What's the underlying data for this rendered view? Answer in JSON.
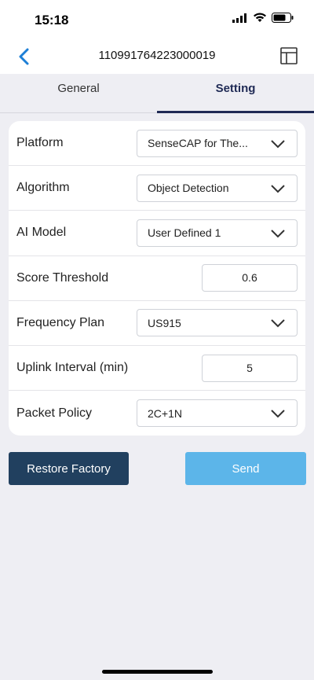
{
  "status_bar": {
    "time": "15:18"
  },
  "nav": {
    "title": "110991764223000019"
  },
  "tabs": [
    {
      "label": "General",
      "active": false
    },
    {
      "label": "Setting",
      "active": true
    }
  ],
  "settings": {
    "platform": {
      "label": "Platform",
      "value": "SenseCAP for The..."
    },
    "algorithm": {
      "label": "Algorithm",
      "value": "Object Detection"
    },
    "ai_model": {
      "label": "AI Model",
      "value": "User Defined 1"
    },
    "score_threshold": {
      "label": "Score Threshold",
      "value": "0.6"
    },
    "frequency_plan": {
      "label": "Frequency Plan",
      "value": "US915"
    },
    "uplink_interval": {
      "label": "Uplink Interval (min)",
      "value": "5"
    },
    "packet_policy": {
      "label": "Packet Policy",
      "value": "2C+1N"
    }
  },
  "actions": {
    "restore_label": "Restore Factory",
    "send_label": "Send"
  },
  "colors": {
    "accent": "#1f2a55",
    "restore_bg": "#21405f",
    "send_bg": "#5cb5e9",
    "back_arrow": "#1d7fd6"
  },
  "icons": {
    "back": "chevron-left-icon",
    "layout": "layout-icon",
    "dropdown": "chevron-down-icon",
    "signal": "signal-icon",
    "wifi": "wifi-icon",
    "battery": "battery-icon"
  }
}
